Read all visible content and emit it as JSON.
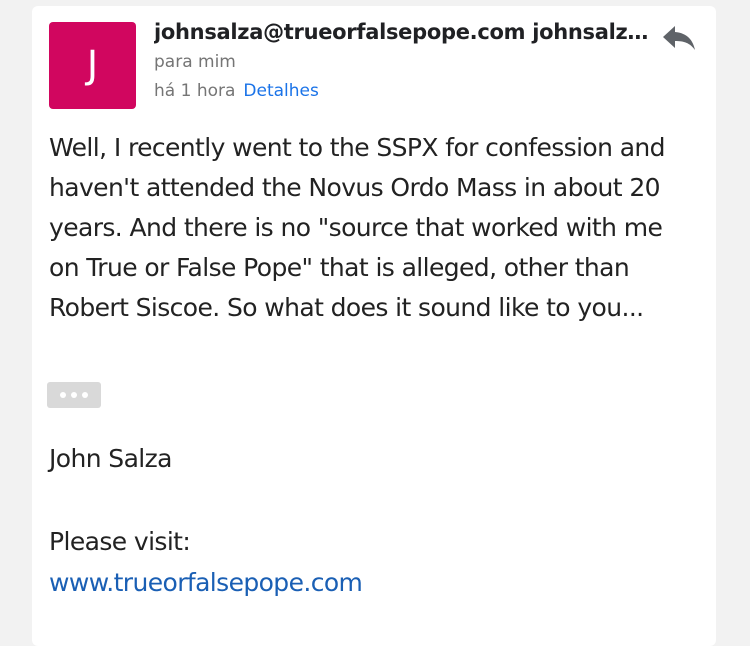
{
  "message": {
    "avatar_letter": "J",
    "avatar_color": "#d1065f",
    "sender": "johnsalza@trueorfalsepope.com johnsalza...",
    "recipient": "para mim",
    "time": "há 1 hora",
    "details_label": "Detalhes",
    "reply_icon": "reply-icon",
    "body": "Well, I recently went to the SSPX for confession and haven't attended the Novus Ordo Mass in about 20 years. And there is no \"source that worked with me on True or False Pope\" that is alleged, other than Robert Siscoe. So what does it sound like to you...",
    "show_trimmed_icon": "more-horizontal-icon",
    "signature_name": "John Salza",
    "visit_text": "Please visit:",
    "link": "www.trueorfalsepope.com",
    "link_color": "#1a5fb4"
  }
}
